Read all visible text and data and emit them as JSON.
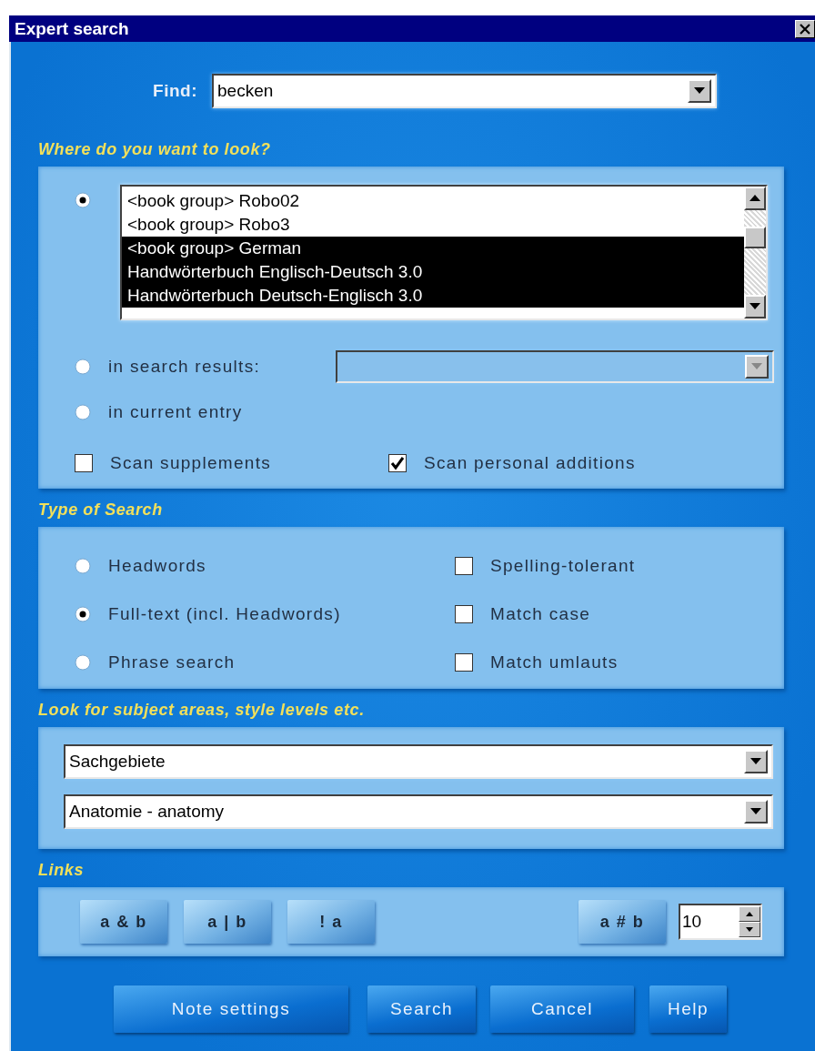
{
  "window": {
    "title": "Expert search"
  },
  "find": {
    "label": "Find:",
    "value": "becken"
  },
  "where": {
    "heading": "Where do you want to look?",
    "options": [
      {
        "kind": "list",
        "selected": true,
        "items": [
          {
            "label": "<book group> Robo02",
            "selected": false
          },
          {
            "label": "<book group> Robo3",
            "selected": false
          },
          {
            "label": "<book group> German",
            "selected": true
          },
          {
            "label": "Handwörterbuch Englisch-Deutsch 3.0",
            "selected": true
          },
          {
            "label": "Handwörterbuch Deutsch-Englisch 3.0",
            "selected": true
          }
        ]
      },
      {
        "kind": "combo",
        "label": "in search results:",
        "selected": false,
        "disabled": true
      },
      {
        "kind": "plain",
        "label": "in current entry",
        "selected": false
      }
    ],
    "checks": [
      {
        "label": "Scan supplements",
        "checked": false
      },
      {
        "label": "Scan personal additions",
        "checked": true
      }
    ]
  },
  "search_type": {
    "heading": "Type of Search",
    "modes": [
      {
        "label": "Headwords",
        "selected": false
      },
      {
        "label": "Full-text (incl. Headwords)",
        "selected": true
      },
      {
        "label": "Phrase search",
        "selected": false
      }
    ],
    "options": [
      {
        "label": "Spelling-tolerant",
        "checked": false
      },
      {
        "label": "Match case",
        "checked": false
      },
      {
        "label": "Match umlauts",
        "checked": false
      }
    ]
  },
  "subjects": {
    "heading": "Look for subject areas, style levels etc.",
    "dropdowns": [
      {
        "value": "Sachgebiete"
      },
      {
        "value": "Anatomie - anatomy"
      }
    ]
  },
  "links": {
    "heading": "Links",
    "operators": [
      "a & b",
      "a | b",
      "! a"
    ],
    "proximity": {
      "label": "a # b",
      "value": "10"
    }
  },
  "buttons": [
    "Note settings",
    "Search",
    "Cancel",
    "Help"
  ]
}
